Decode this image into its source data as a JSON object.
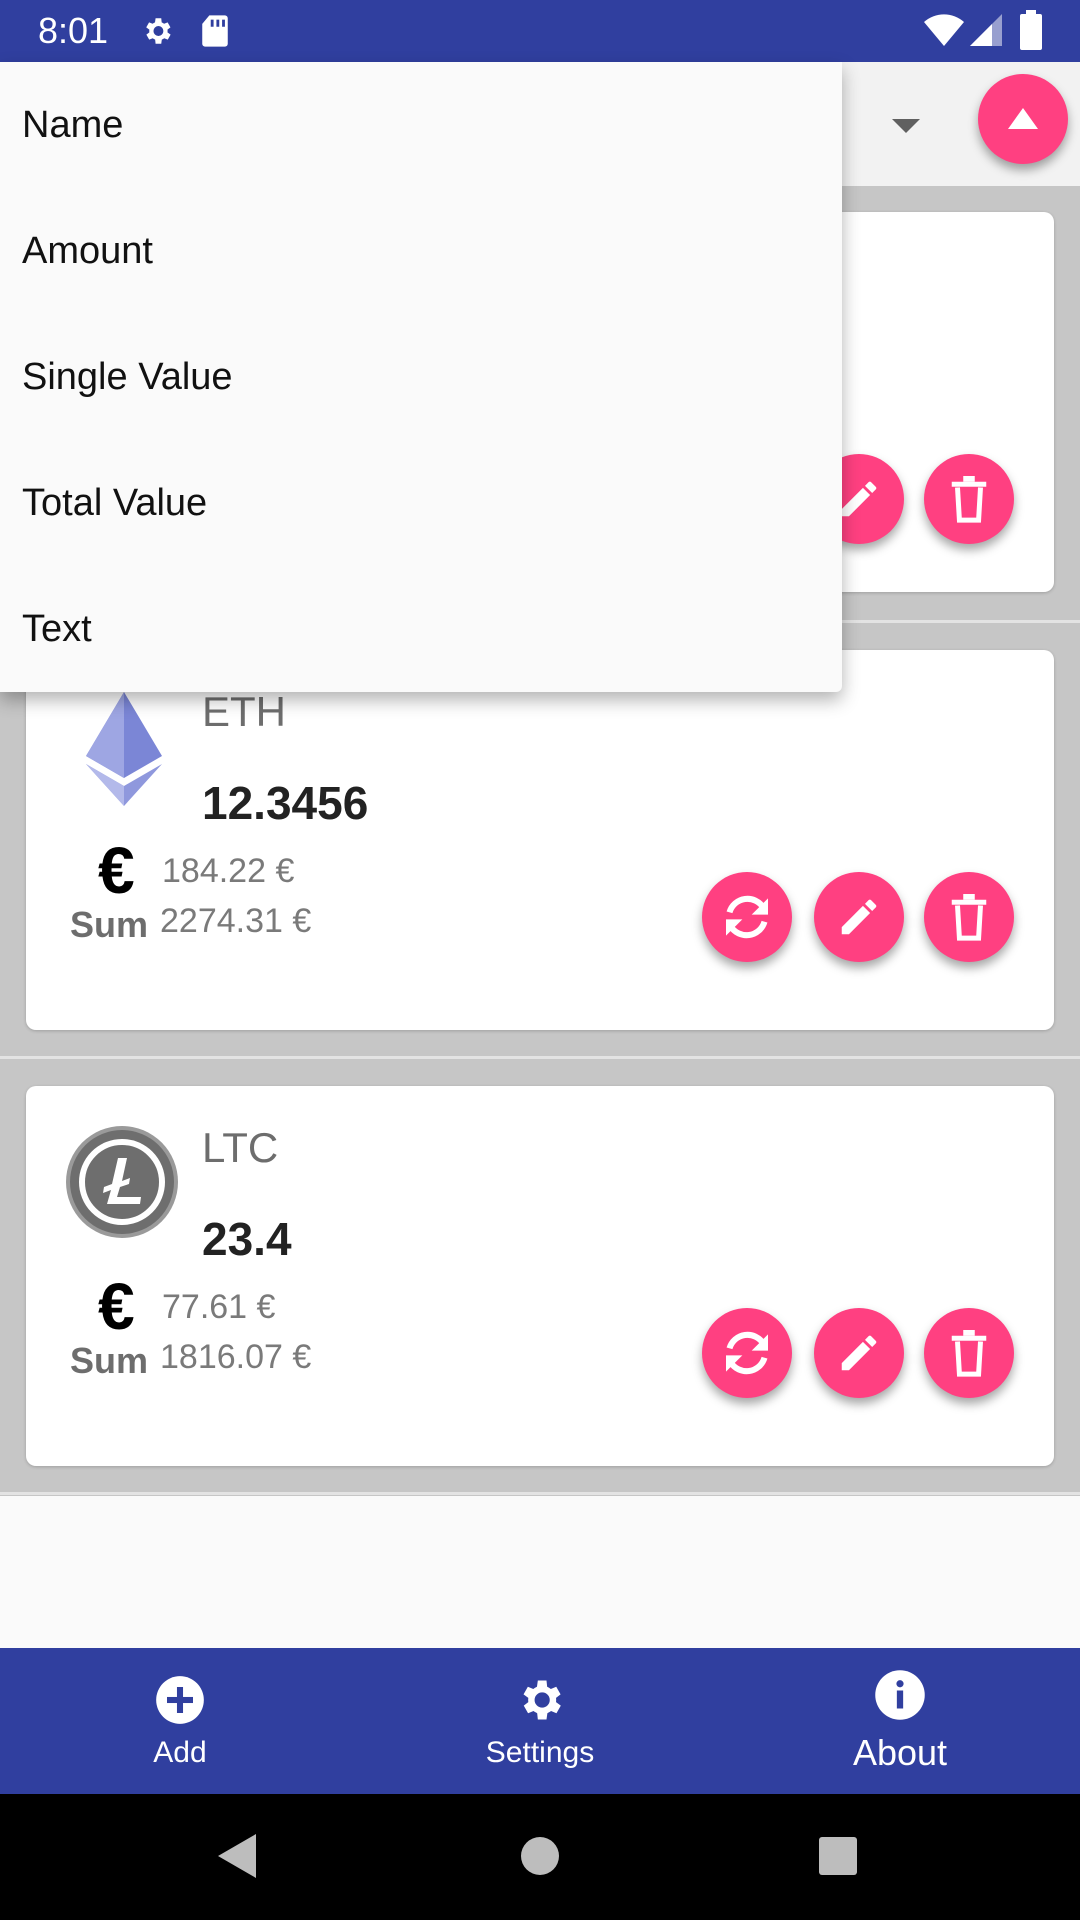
{
  "status_bar": {
    "time": "8:01",
    "left_icons": [
      "settings-gear-icon",
      "sd-card-icon"
    ],
    "right_icons": [
      "wifi-icon",
      "signal-icon",
      "battery-icon"
    ]
  },
  "sort_dropdown": {
    "options": [
      "Name",
      "Amount",
      "Single Value",
      "Total Value",
      "Text"
    ]
  },
  "coins": [
    {
      "symbol": "ETH",
      "amount": "12.3456",
      "currency_symbol": "€",
      "single_value": "184.22 €",
      "sum_label": "Sum",
      "sum_value": "2274.31 €"
    },
    {
      "symbol": "LTC",
      "amount": "23.4",
      "currency_symbol": "€",
      "single_value": "77.61 €",
      "sum_label": "Sum",
      "sum_value": "1816.07 €"
    }
  ],
  "bottom_nav": {
    "items": [
      {
        "label": "Add",
        "icon": "add-circle-icon"
      },
      {
        "label": "Settings",
        "icon": "gear-icon"
      },
      {
        "label": "About",
        "icon": "info-icon"
      }
    ]
  },
  "colors": {
    "primary": "#303f9f",
    "accent": "#ff4081",
    "list_background": "#c6c6c6"
  }
}
